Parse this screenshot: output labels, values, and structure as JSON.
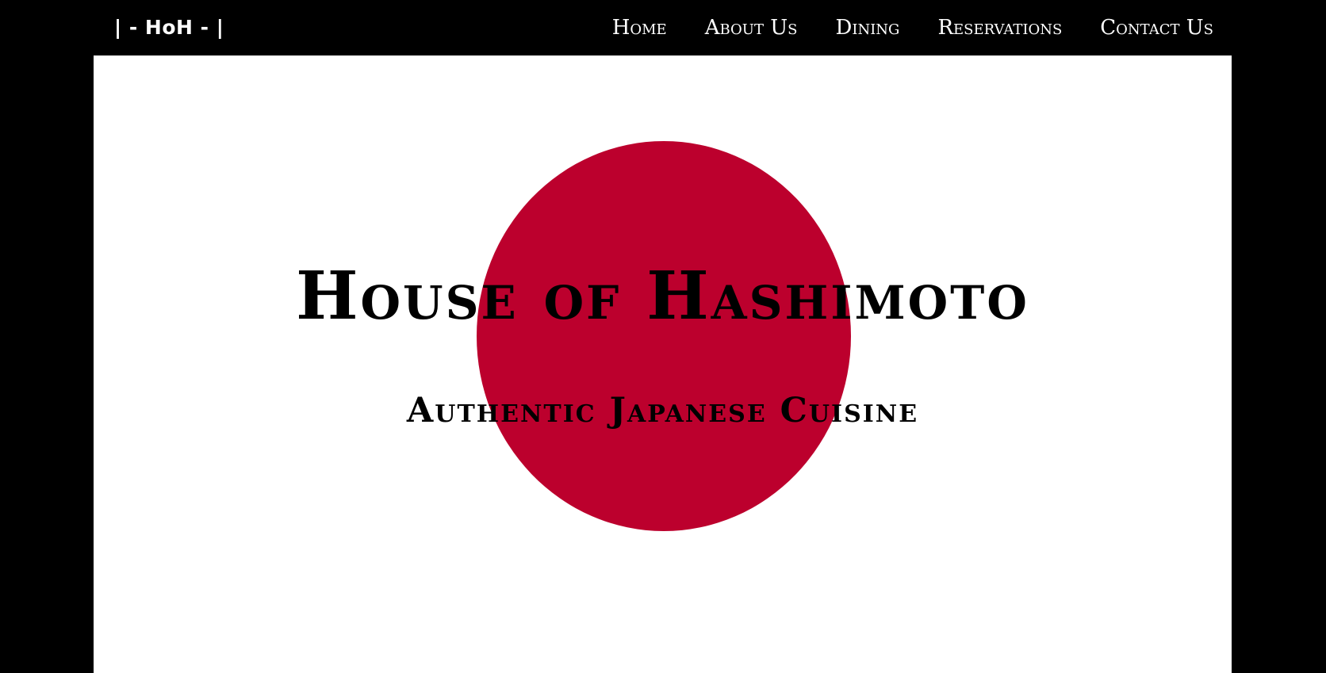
{
  "header": {
    "brand": "| - HoH - |",
    "nav": [
      {
        "label": "Home"
      },
      {
        "label": "About Us"
      },
      {
        "label": "Dining"
      },
      {
        "label": "Reservations"
      },
      {
        "label": "Contact Us"
      }
    ]
  },
  "hero": {
    "title": "House of Hashimoto",
    "subtitle": "Authentic Japanese Cuisine"
  },
  "colors": {
    "background": "#000000",
    "hero_background": "#ffffff",
    "sun": "#bc002d",
    "nav_text": "#ffffff",
    "hero_text": "#000000"
  }
}
